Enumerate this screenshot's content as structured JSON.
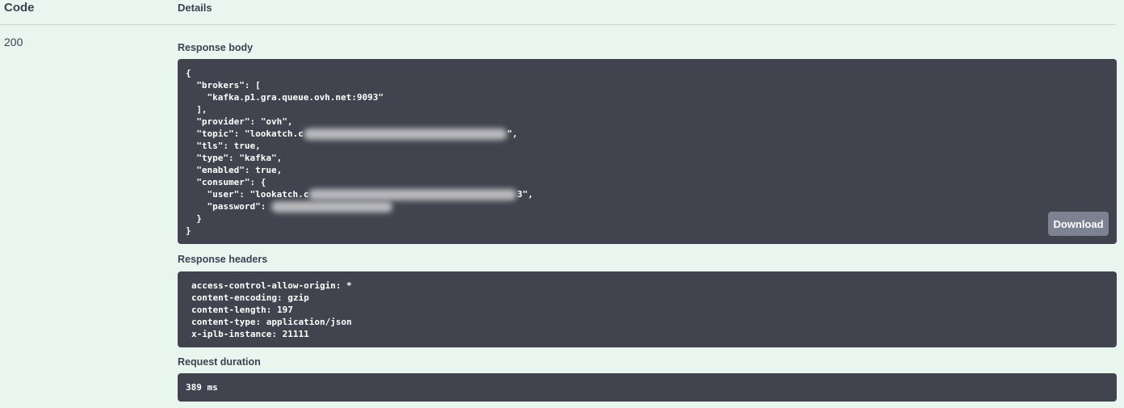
{
  "table": {
    "code_header": "Code",
    "details_header": "Details"
  },
  "response": {
    "code": "200",
    "body_label": "Response body",
    "body_lines": {
      "l1": "{",
      "l2": "  \"brokers\": [",
      "l3": "    \"kafka.p1.gra.queue.ovh.net:9093\"",
      "l4": "  ],",
      "l5": "  \"provider\": \"ovh\",",
      "l6a": "  \"topic\": \"lookatch.c",
      "l6b": "\",",
      "l7": "  \"tls\": true,",
      "l8": "  \"type\": \"kafka\",",
      "l9": "  \"enabled\": true,",
      "l10": "  \"consumer\": {",
      "l11a": "    \"user\": \"lookatch.c",
      "l11b": "3\",",
      "l12": "    \"password\": ",
      "l13": "  }",
      "l14": "}"
    },
    "download_label": "Download",
    "headers_label": "Response headers",
    "headers": {
      "h1": "access-control-allow-origin: *",
      "h2": "content-encoding: gzip",
      "h3": "content-length: 197",
      "h4": "content-type: application/json",
      "h5": "x-iplb-instance: 21111"
    },
    "duration_label": "Request duration",
    "duration": "389 ms"
  }
}
